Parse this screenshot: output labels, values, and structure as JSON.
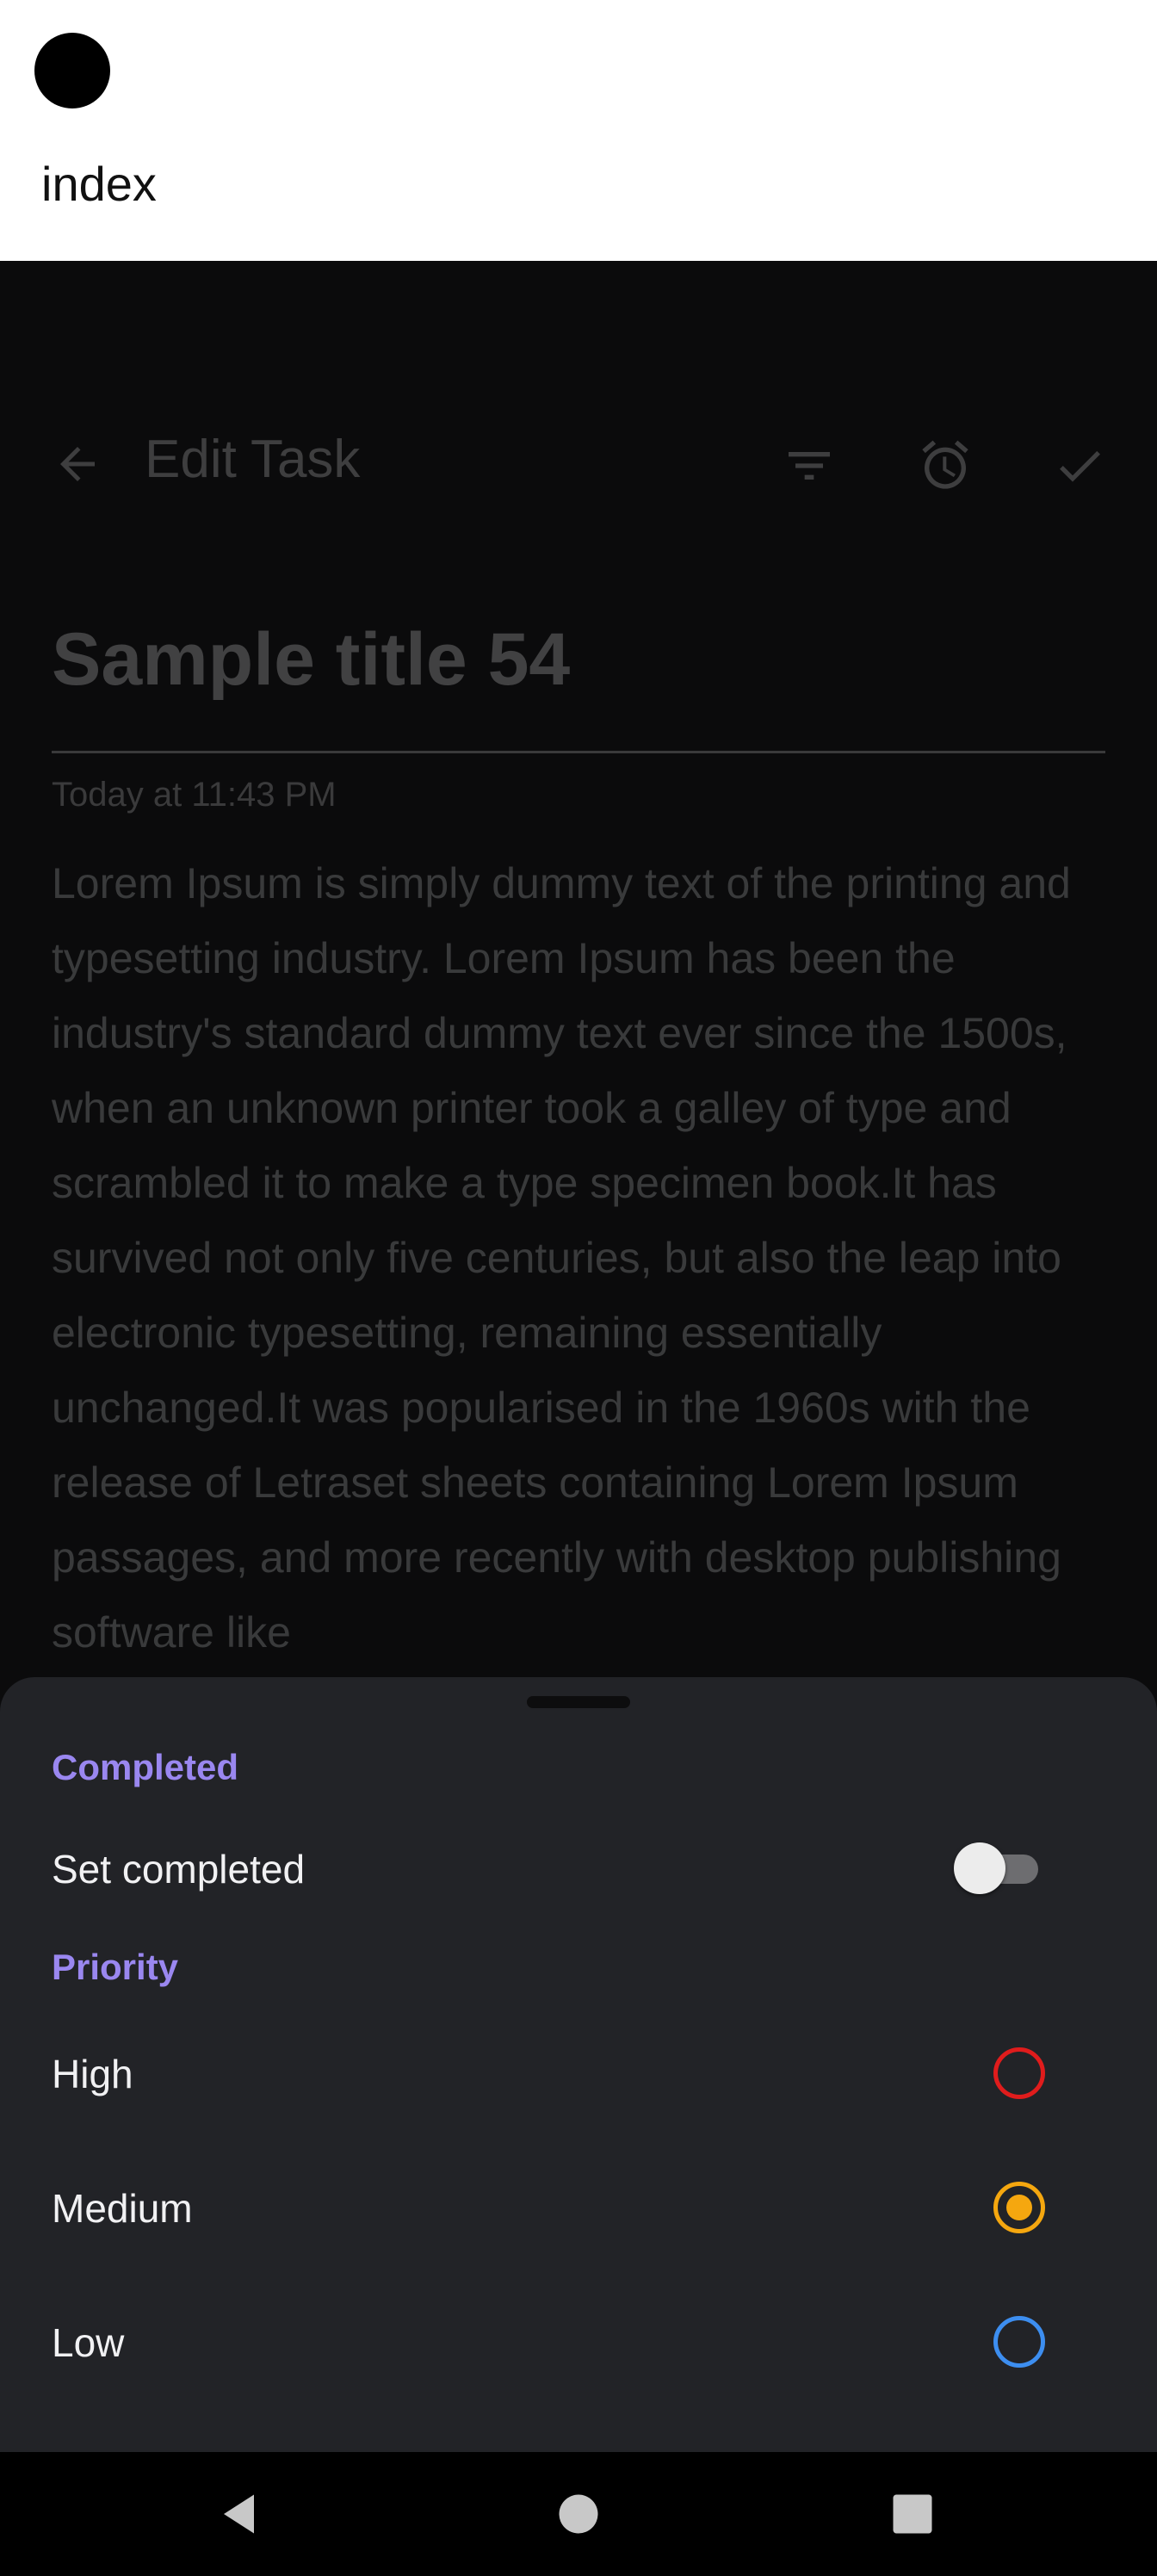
{
  "top_header": {
    "title": "index"
  },
  "toolbar": {
    "title": "Edit Task",
    "icons": [
      "back-arrow-icon",
      "filter-icon",
      "alarm-icon",
      "check-icon"
    ]
  },
  "task": {
    "title": "Sample title 54",
    "date": "Today at 11:43 PM",
    "body": "Lorem Ipsum is simply dummy text of the printing and typesetting industry. Lorem Ipsum has been the industry's standard dummy text ever since the 1500s, when an unknown printer took a galley of type and scrambled it to make a type specimen book.It has survived not only five centuries, but also the leap into electronic typesetting, remaining essentially unchanged.It was popularised in the 1960s with the release of Letraset sheets containing Lorem Ipsum passages, and more recently with desktop publishing software like"
  },
  "sheet": {
    "completed_section": "Completed",
    "set_completed_label": "Set completed",
    "set_completed_on": false,
    "priority_section": "Priority",
    "priorities": [
      {
        "label": "High",
        "color": "#e01c1c",
        "selected": false
      },
      {
        "label": "Medium",
        "color": "#f5a70f",
        "selected": true
      },
      {
        "label": "Low",
        "color": "#3d8ef0",
        "selected": false
      }
    ]
  },
  "colors": {
    "accent": "#9a87f0",
    "sheet_bg": "#222327"
  },
  "navbar": {
    "icons": [
      "back-triangle-icon",
      "home-circle-icon",
      "recents-square-icon"
    ]
  }
}
